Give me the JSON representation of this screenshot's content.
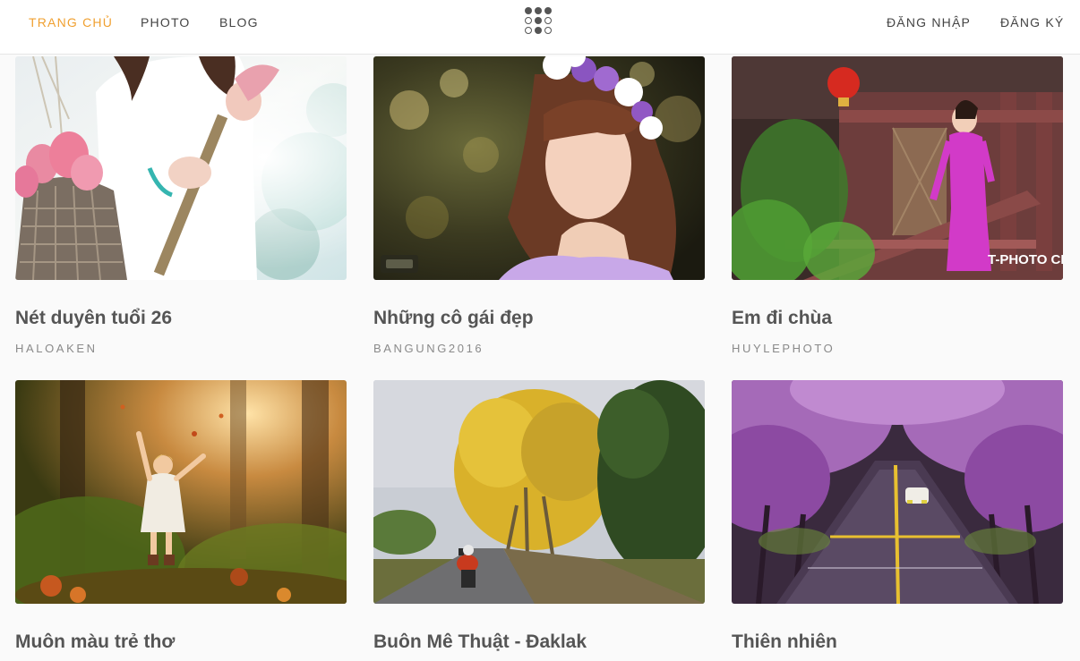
{
  "nav": {
    "home": "TRANG CHỦ",
    "photo": "PHOTO",
    "blog": "BLOG",
    "login": "ĐĂNG NHẬP",
    "register": "ĐĂNG KÝ",
    "logo_icon": "dot-grid-logo-icon",
    "active_color": "#f0a030"
  },
  "cards": [
    {
      "title": "Nét duyên tuổi 26",
      "author": "HALOAKEN",
      "image": "woman-with-lotus-photo"
    },
    {
      "title": "Những cô gái đẹp",
      "author": "BANGUNG2016",
      "image": "girl-flower-crown-photo"
    },
    {
      "title": "Em đi chùa",
      "author": "HUYLEPHOTO",
      "image": "woman-at-temple-photo",
      "watermark": "T-PHOTO CLUB"
    },
    {
      "title": "Muôn màu trẻ thơ",
      "author": "",
      "image": "child-in-forest-photo"
    },
    {
      "title": "Buôn Mê Thuật - Đaklak",
      "author": "",
      "image": "yellow-tree-road-photo"
    },
    {
      "title": "Thiên nhiên",
      "author": "",
      "image": "purple-blossom-road-photo"
    }
  ]
}
